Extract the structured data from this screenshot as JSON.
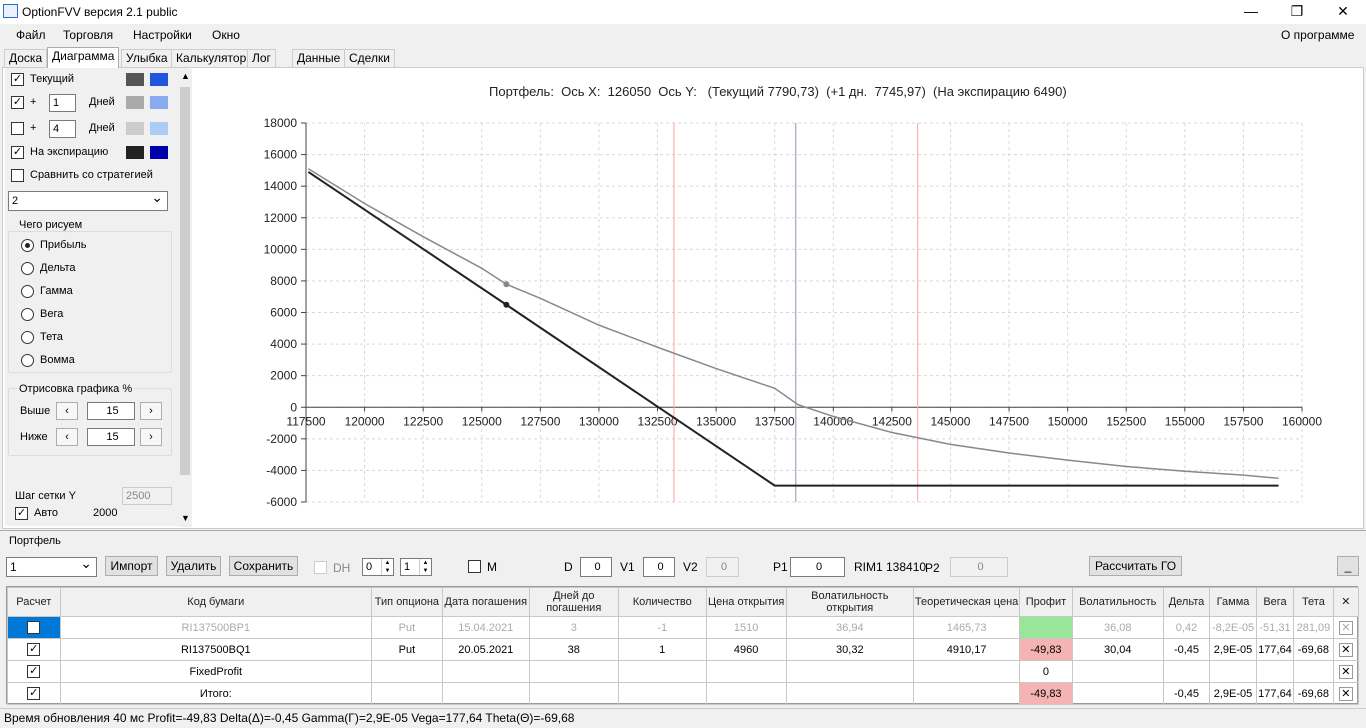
{
  "window": {
    "title": "OptionFVV версия 2.1 public",
    "min": "—",
    "max": "❐",
    "close": "✕"
  },
  "menu": {
    "file": "Файл",
    "trade": "Торговля",
    "settings": "Настройки",
    "window": "Окно",
    "about": "О программе"
  },
  "tabs": [
    "Доска",
    "Диаграмма",
    "Улыбка",
    "Калькулятор",
    "Лог",
    "Данные",
    "Сделки"
  ],
  "left": {
    "current": "Текущий",
    "plus": "+",
    "days": "Дней",
    "days1": "1",
    "days2": "4",
    "expiry": "На экспирацию",
    "compare": "Сравнить со стратегией",
    "strategy": "2",
    "what_title": "Чего рисуем",
    "what": [
      "Прибыль",
      "Дельта",
      "Гамма",
      "Вега",
      "Тета",
      "Вомма"
    ],
    "draw_title": "Отрисовка графика %",
    "above": "Выше",
    "below": "Ниже",
    "above_val": "15",
    "below_val": "15",
    "grid_step": "Шаг сетки Y",
    "grid_step_val": "2500",
    "auto": "Авто",
    "auto_val": "2000",
    "colors": {
      "cur1": "#555555",
      "cur2": "#2255dd",
      "d1a": "#aaaaaa",
      "d1b": "#88aaee",
      "d4a": "#cccccc",
      "d4b": "#aaccf5",
      "expa": "#222222",
      "expb": "#0000aa"
    }
  },
  "chart_title": "Портфель:  Ось X:  126050  Ось Y:   (Текущий 7790,73)  (+1 дн.  7745,97)  (На экспирацию 6490)",
  "chart_data": {
    "type": "line",
    "xlim": [
      117500,
      160000
    ],
    "ylim": [
      -6000,
      18000
    ],
    "xticks": [
      "117500",
      "120000",
      "122500",
      "125000",
      "127500",
      "130000",
      "132500",
      "135000",
      "137500",
      "140000",
      "142500",
      "145000",
      "147500",
      "150000",
      "152500",
      "155000",
      "157500",
      "160000"
    ],
    "yticks": [
      "18000",
      "16000",
      "14000",
      "12000",
      "10000",
      "8000",
      "6000",
      "4000",
      "2000",
      "0",
      "-2000",
      "-4000",
      "-6000"
    ],
    "series": [
      {
        "color": "#222222",
        "x": [
          117600,
          126050,
          137500,
          159000
        ],
        "y": [
          14900,
          6490,
          -4960,
          -4960
        ]
      },
      {
        "color": "#888888",
        "x": [
          117600,
          120000,
          122500,
          125000,
          126050,
          127500,
          130000,
          132500,
          135000,
          137500,
          138500,
          140000,
          142500,
          145000,
          147500,
          150000,
          152500,
          155000,
          157500,
          159000
        ],
        "y": [
          15100,
          12900,
          10800,
          8800,
          7790,
          6900,
          5200,
          3800,
          2450,
          1200,
          160,
          -580,
          -1600,
          -2350,
          -2900,
          -3350,
          -3750,
          -4050,
          -4300,
          -4500
        ]
      }
    ],
    "markers": [
      {
        "x": 126050,
        "y": 6490,
        "color": "#222222"
      },
      {
        "x": 126050,
        "y": 7790,
        "color": "#888888"
      }
    ],
    "vlines": [
      {
        "x": 133200,
        "color": "#f4a6a6"
      },
      {
        "x": 143600,
        "color": "#f4a6a6"
      },
      {
        "x": 138400,
        "color": "#8a96aa"
      }
    ],
    "grid": true
  },
  "portfolio": {
    "label": "Портфель",
    "select": "1",
    "import": "Импорт",
    "delete": "Удалить",
    "save": "Сохранить",
    "dh": "DH",
    "spin1": "0",
    "spin2": "1",
    "m": "M",
    "d": "D",
    "d_val": "0",
    "v1": "V1",
    "v1_val": "0",
    "v2": "V2",
    "v2_val": "0",
    "p1": "P1",
    "p1_val": "0",
    "rim": "RIM1 138410",
    "p2": "P2",
    "p2_val": "0",
    "calc_go": "Рассчитать ГО",
    "minus": "_"
  },
  "table": {
    "headers": [
      "Расчет",
      "Код бумаги",
      "Тип опциона",
      "Дата погашения",
      "Дней до погашения",
      "Количество",
      "Цена открытия",
      "Волатильность открытия",
      "Теоретическая цена",
      "Профит",
      "Волатильность",
      "Дельта",
      "Гамма",
      "Вега",
      "Тета",
      "✕"
    ],
    "rows": [
      [
        "RI137500BP1",
        "Put",
        "15.04.2021",
        "3",
        "-1",
        "1510",
        "36,94",
        "1465,73",
        "",
        "36,08",
        "0,42",
        "-8,2E-05",
        "-51,31",
        "281,09"
      ],
      [
        "RI137500BQ1",
        "Put",
        "20.05.2021",
        "38",
        "1",
        "4960",
        "30,32",
        "4910,17",
        "-49,83",
        "30,04",
        "-0,45",
        "2,9E-05",
        "177,64",
        "-69,68"
      ],
      [
        "FixedProfit",
        "",
        "",
        "",
        "",
        "",
        "",
        "",
        "0",
        "",
        "",
        "",
        "",
        ""
      ],
      [
        "Итого:",
        "",
        "",
        "",
        "",
        "",
        "",
        "",
        "-49,83",
        "",
        "-0,45",
        "2,9E-05",
        "177,64",
        "-69,68"
      ]
    ]
  },
  "status": "Время обновления 40 мс  Profit=-49,83 Delta(Δ)=-0,45 Gamma(Γ)=2,9E-05 Vega=177,64 Theta(Θ)=-69,68"
}
